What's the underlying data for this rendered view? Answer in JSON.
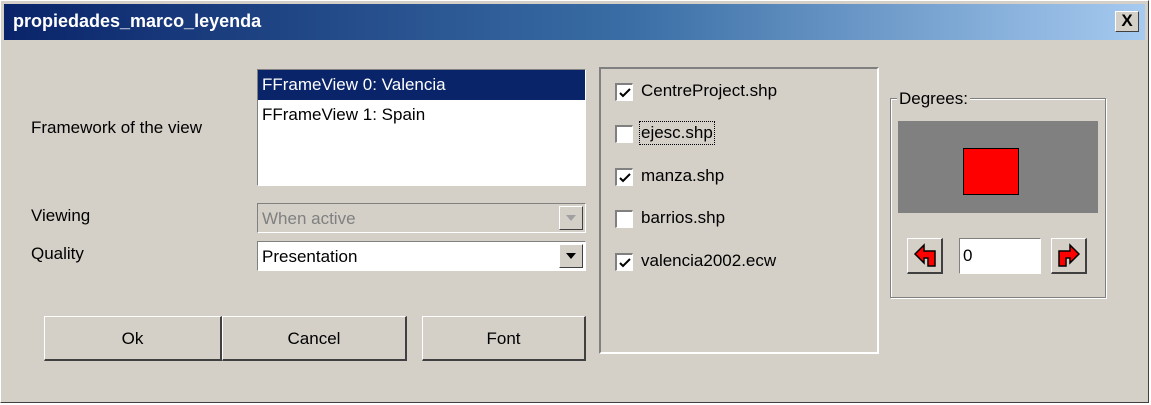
{
  "window": {
    "title": "propiedades_marco_leyenda",
    "close_label": "X"
  },
  "form": {
    "framework_label": "Framework of the view",
    "framework_items": [
      {
        "label": "FFrameView 0: Valencia",
        "selected": true
      },
      {
        "label": "FFrameView 1: Spain",
        "selected": false
      }
    ],
    "viewing_label": "Viewing",
    "viewing_value": "When active",
    "viewing_enabled": false,
    "quality_label": "Quality",
    "quality_value": "Presentation"
  },
  "buttons": {
    "ok": "Ok",
    "cancel": "Cancel",
    "font": "Font"
  },
  "layers": [
    {
      "name": "CentreProject.shp",
      "checked": true
    },
    {
      "name": "ejesc.shp",
      "checked": false,
      "focused": true
    },
    {
      "name": "manza.shp",
      "checked": true
    },
    {
      "name": "barrios.shp",
      "checked": false
    },
    {
      "name": "valencia2002.ecw",
      "checked": true
    }
  ],
  "rotation": {
    "group_label": "Degrees:",
    "degrees_value": "0",
    "preview_color": "#ff0000",
    "icons": {
      "left": "rotate-left-icon",
      "right": "rotate-right-icon"
    }
  }
}
